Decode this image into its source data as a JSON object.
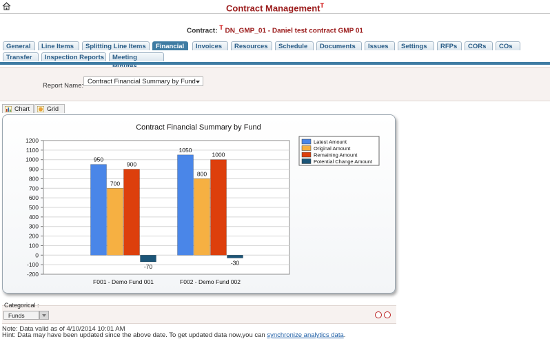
{
  "header": {
    "title": "Contract Management",
    "title_mark": "T",
    "contract_label": "Contract:",
    "contract_mark": "T",
    "contract_value": "DN_GMP_01 - Daniel test contract GMP 01"
  },
  "tabs_row1": [
    {
      "label": "General"
    },
    {
      "label": "Line Items"
    },
    {
      "label": "Splitting Line Items"
    },
    {
      "label": "Financial",
      "active": true
    },
    {
      "label": "Invoices"
    },
    {
      "label": "Resources"
    },
    {
      "label": "Schedule"
    },
    {
      "label": "Documents"
    },
    {
      "label": "Issues"
    },
    {
      "label": "Settings"
    },
    {
      "label": "RFPs"
    },
    {
      "label": "CORs"
    },
    {
      "label": "COs"
    }
  ],
  "tabs_row2": [
    {
      "label": "Transfer"
    },
    {
      "label": "Inspection Reports"
    },
    {
      "label": "Meeting Minutes"
    }
  ],
  "report": {
    "label": "Report Name:",
    "mark": "T",
    "selected": "Contract Financial Summary by Fund"
  },
  "view_tabs": {
    "chart": "Chart",
    "grid": "Grid"
  },
  "chart_data": {
    "type": "bar",
    "title": "Contract Financial Summary by Fund",
    "categories": [
      "F001 - Demo Fund 001",
      "F002 - Demo Fund 002"
    ],
    "series": [
      {
        "name": "Latest Amount",
        "color": "#4a86e8",
        "values": [
          950,
          1050
        ]
      },
      {
        "name": "Original Amount",
        "color": "#f6b042",
        "values": [
          700,
          800
        ]
      },
      {
        "name": "Remaining Amount",
        "color": "#dd3f0c",
        "values": [
          900,
          1000
        ]
      },
      {
        "name": "Potential Change Amount",
        "color": "#1c5578",
        "values": [
          -70,
          -30
        ]
      }
    ],
    "data_labels": [
      [
        "950",
        "700",
        "900",
        "-70"
      ],
      [
        "1050",
        "800",
        "1000",
        "-30"
      ]
    ],
    "ylim": [
      -200,
      1200
    ],
    "yticks": [
      -200,
      -100,
      0,
      100,
      200,
      300,
      400,
      500,
      600,
      700,
      800,
      900,
      1000,
      1100,
      1200
    ],
    "grid": true,
    "legend_position": "top-right"
  },
  "categorical": {
    "label": "Categorical :",
    "selected": "Funds"
  },
  "footer": {
    "note": "Note: Data valid as of 4/10/2014 10:01 AM",
    "hint_prefix": "Hint: Data may have been updated since the above date. To get updated data now,you can ",
    "hint_link": "synchronize analytics data",
    "hint_suffix": "."
  }
}
